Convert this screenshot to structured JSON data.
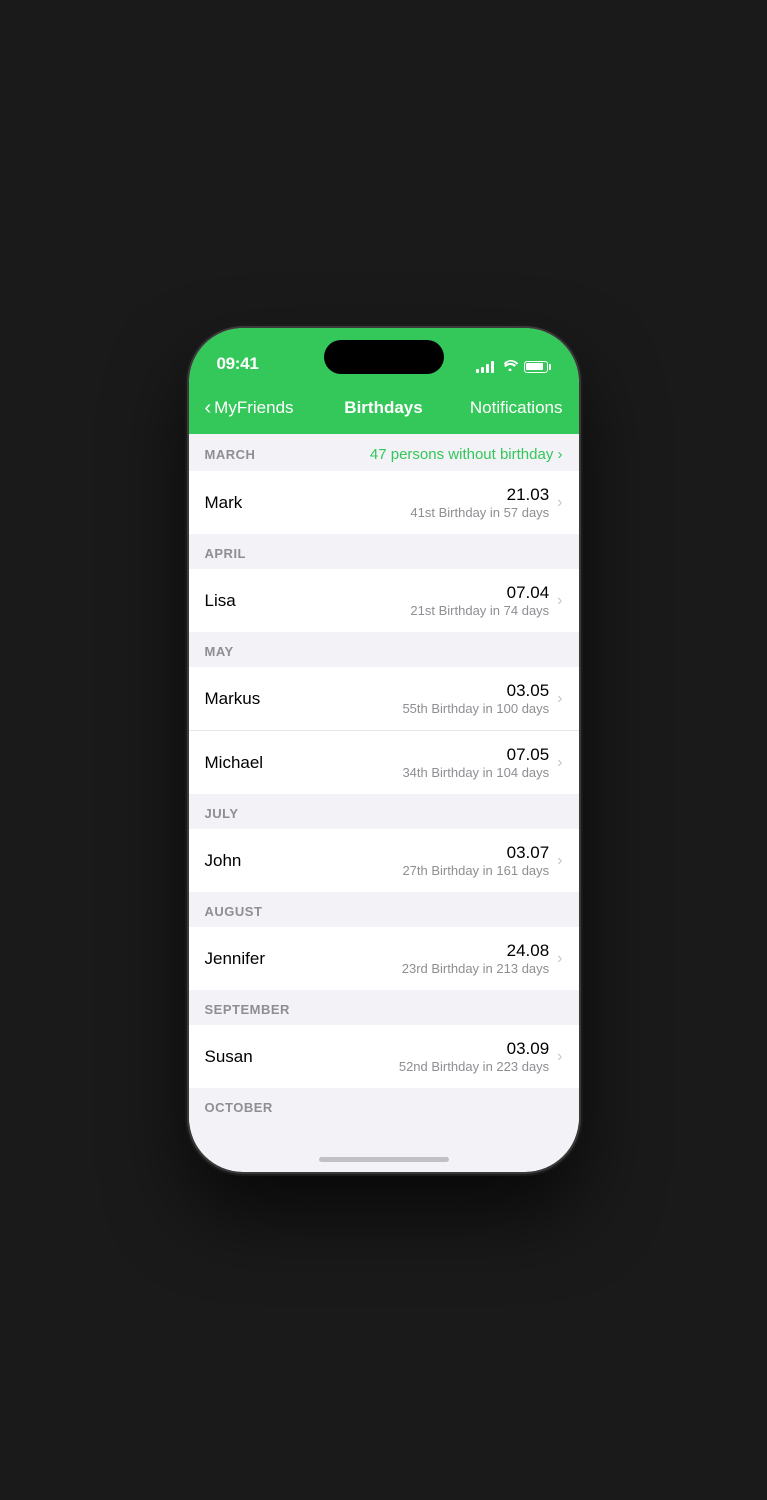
{
  "statusBar": {
    "time": "09:41"
  },
  "navBar": {
    "backLabel": "MyFriends",
    "title": "Birthdays",
    "rightLabel": "Notifications"
  },
  "sections": [
    {
      "id": "march",
      "month": "MARCH",
      "showLink": true,
      "linkText": "47 persons without birthday",
      "items": [
        {
          "name": "Mark",
          "date": "21.03",
          "sub": "41st Birthday in 57 days"
        }
      ]
    },
    {
      "id": "april",
      "month": "APRIL",
      "showLink": false,
      "items": [
        {
          "name": "Lisa",
          "date": "07.04",
          "sub": "21st Birthday in 74 days"
        }
      ]
    },
    {
      "id": "may",
      "month": "MAY",
      "showLink": false,
      "items": [
        {
          "name": "Markus",
          "date": "03.05",
          "sub": "55th Birthday in 100 days"
        },
        {
          "name": "Michael",
          "date": "07.05",
          "sub": "34th Birthday in 104 days"
        }
      ]
    },
    {
      "id": "july",
      "month": "JULY",
      "showLink": false,
      "items": [
        {
          "name": "John",
          "date": "03.07",
          "sub": "27th Birthday in 161 days"
        }
      ]
    },
    {
      "id": "august",
      "month": "AUGUST",
      "showLink": false,
      "items": [
        {
          "name": "Jennifer",
          "date": "24.08",
          "sub": "23rd Birthday in 213 days"
        }
      ]
    },
    {
      "id": "september",
      "month": "SEPTEMBER",
      "showLink": false,
      "items": [
        {
          "name": "Susan",
          "date": "03.09",
          "sub": "52nd Birthday in 223 days"
        }
      ]
    },
    {
      "id": "october",
      "month": "OCTOBER",
      "showLink": false,
      "items": []
    }
  ],
  "colors": {
    "green": "#34c759",
    "sectionBg": "#f2f2f7",
    "listBg": "#ffffff",
    "separator": "#e5e5ea",
    "textPrimary": "#000000",
    "textSecondary": "#8e8e93",
    "chevron": "#c7c7cc"
  }
}
